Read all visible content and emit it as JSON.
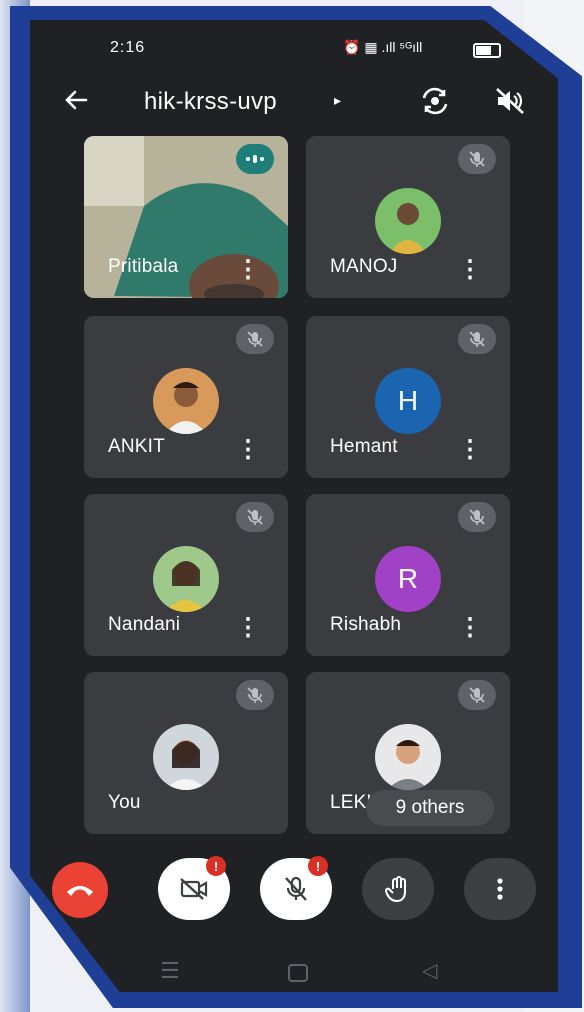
{
  "status": {
    "time": "2:16",
    "icons": "⏰ ▦ .ıll ⁵ᴳıll"
  },
  "meeting": {
    "title": "hik-krss-uvp",
    "chevron": "▸"
  },
  "participants": [
    {
      "name": "Pritibala",
      "type": "video"
    },
    {
      "name": "MANOJ",
      "type": "photo"
    },
    {
      "name": "ANKIT",
      "type": "photo"
    },
    {
      "name": "Hemant",
      "type": "letter",
      "letter": "H",
      "color": "#1a64b0"
    },
    {
      "name": "Nandani",
      "type": "photo"
    },
    {
      "name": "Rishabh",
      "type": "letter",
      "letter": "R",
      "color": "#a142c6"
    },
    {
      "name": "You",
      "type": "photo"
    },
    {
      "name": "LEKH",
      "type": "photo"
    }
  ],
  "others_chip": "9 others",
  "more_glyph": "⋮",
  "alert_glyph": "!",
  "nav": {
    "menu": "☰",
    "back": "◁"
  },
  "colors": {
    "background": "#202124",
    "tile": "#3b3c3f",
    "end_call": "#ea4335",
    "speaking": "#1e7e7a"
  }
}
